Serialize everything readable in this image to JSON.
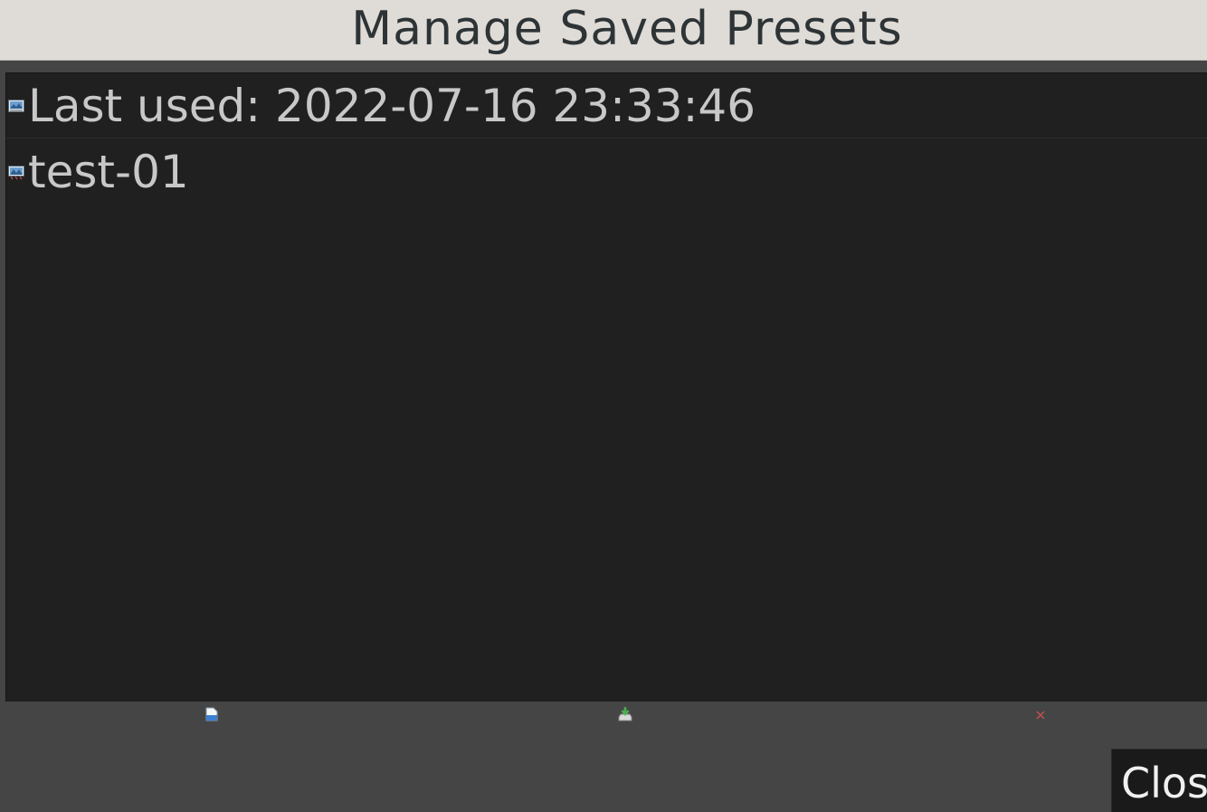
{
  "window": {
    "title": "Manage Saved Presets"
  },
  "presets": {
    "items": [
      {
        "label": "Last used: 2022-07-16 23:33:46",
        "icon": "preset-image-icon"
      },
      {
        "label": "test-01",
        "icon": "preset-image-icon"
      }
    ]
  },
  "toolbar": {
    "open_icon": "open-file-icon",
    "save_icon": "save-download-icon",
    "delete_icon": "delete-x-icon"
  },
  "buttons": {
    "close_label": "Close"
  },
  "colors": {
    "list_background": "#202020",
    "dialog_background": "#454545",
    "titlebar_background": "#dfdcd8",
    "delete_accent": "#c0504d",
    "save_accent": "#4caf50"
  }
}
